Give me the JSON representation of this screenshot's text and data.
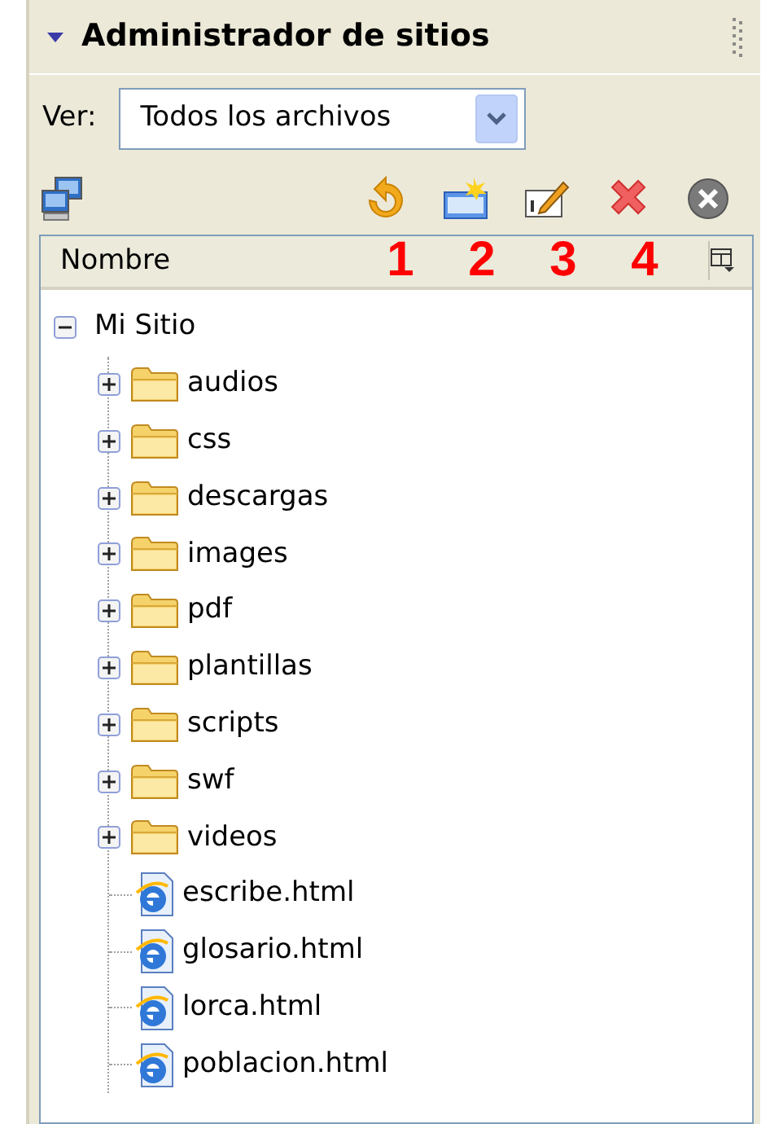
{
  "panel": {
    "title": "Administrador de sitios",
    "collapsed": false
  },
  "view": {
    "label": "Ver:",
    "value": "Todos los archivos"
  },
  "annotations": [
    "1",
    "2",
    "3",
    "4"
  ],
  "columns": [
    "Nombre"
  ],
  "tree": [
    {
      "label": "Mi Sitio",
      "expanded": true,
      "children": [
        {
          "label": "audios",
          "kind": "folder",
          "expanded": false
        },
        {
          "label": "css",
          "kind": "folder",
          "expanded": false
        },
        {
          "label": "descargas",
          "kind": "folder",
          "expanded": false
        },
        {
          "label": "images",
          "kind": "folder",
          "expanded": false
        },
        {
          "label": "pdf",
          "kind": "folder",
          "expanded": false
        },
        {
          "label": "plantillas",
          "kind": "folder",
          "expanded": false
        },
        {
          "label": "scripts",
          "kind": "folder",
          "expanded": false
        },
        {
          "label": "swf",
          "kind": "folder",
          "expanded": false
        },
        {
          "label": "videos",
          "kind": "folder",
          "expanded": false
        },
        {
          "label": "escribe.html",
          "kind": "file"
        },
        {
          "label": "glosario.html",
          "kind": "file"
        },
        {
          "label": "lorca.html",
          "kind": "file"
        },
        {
          "label": "poblacion.html",
          "kind": "file"
        }
      ]
    }
  ]
}
